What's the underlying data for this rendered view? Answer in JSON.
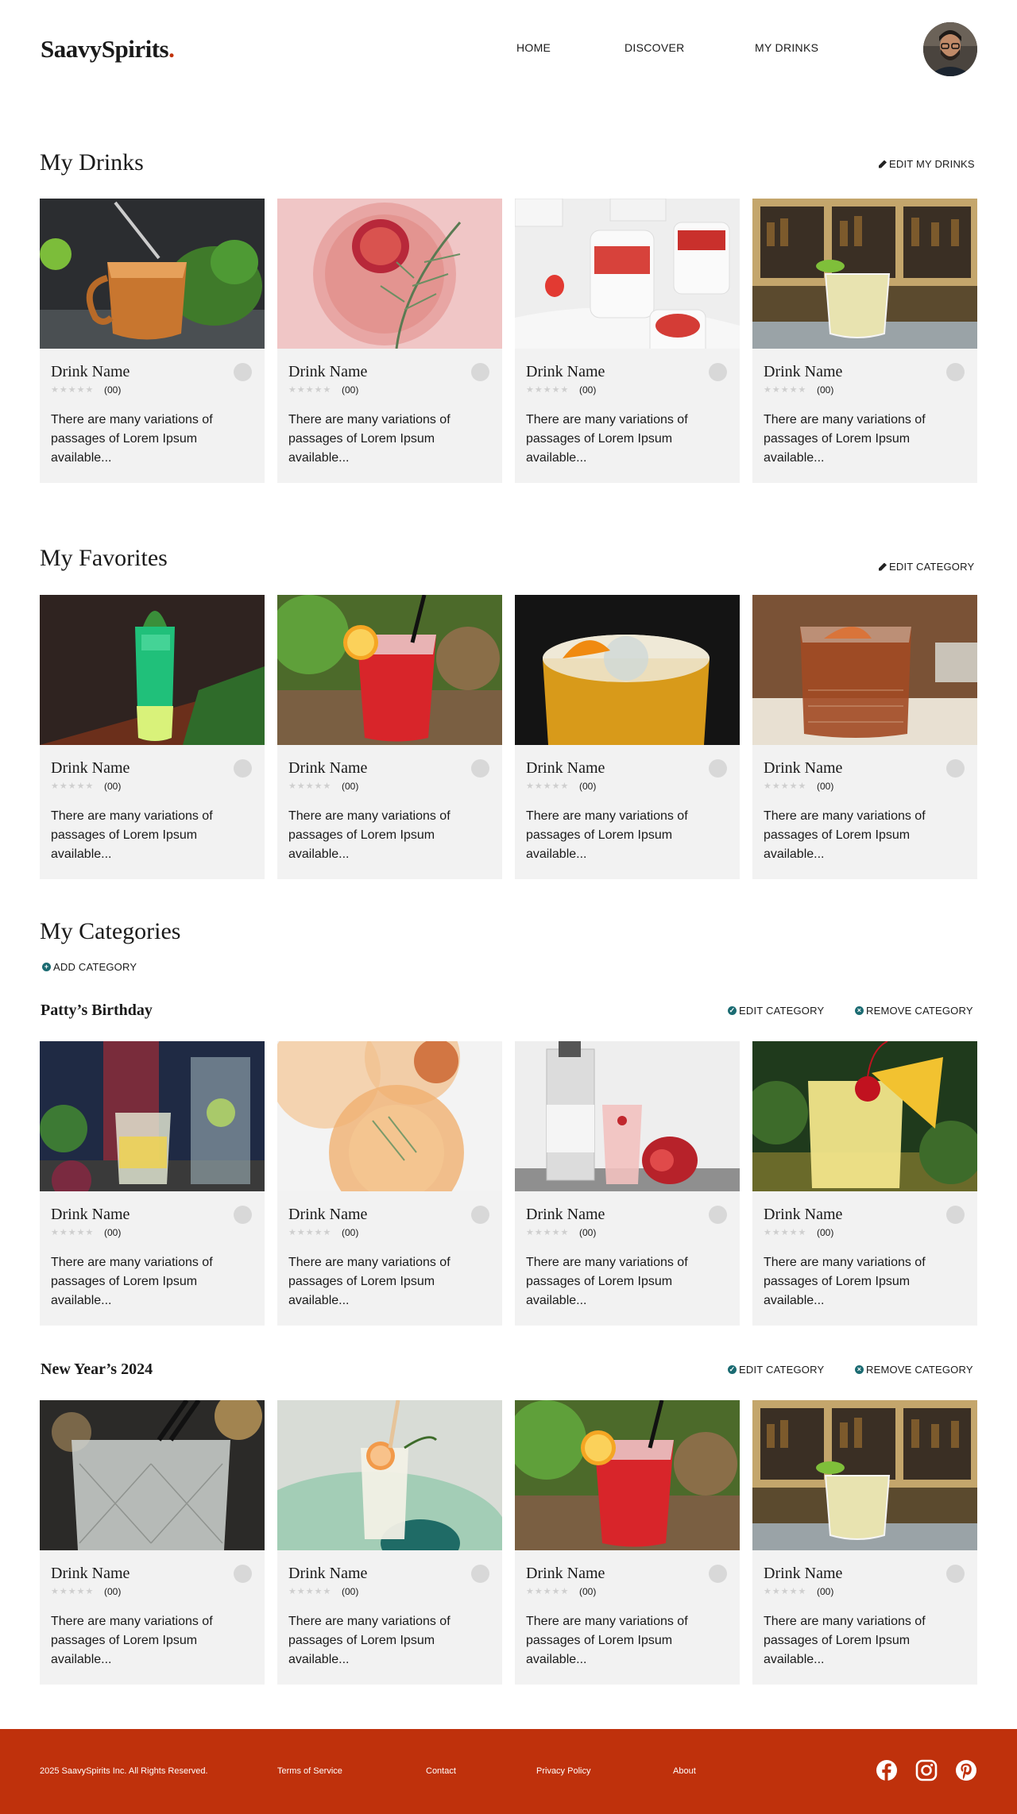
{
  "header": {
    "logo": "SaavySpirits",
    "logo_dot": ".",
    "nav": [
      "HOME",
      "DISCOVER",
      "MY DRINKS"
    ]
  },
  "my_drinks": {
    "title": "My Drinks",
    "action": "EDIT MY DRINKS"
  },
  "my_favorites": {
    "title": "My Favorites",
    "action": "EDIT CATEGORY"
  },
  "my_categories": {
    "title": "My Categories",
    "add": "ADD CATEGORY",
    "edit": "EDIT CATEGORY",
    "remove": "REMOVE CATEGORY",
    "groups": [
      "Patty’s Birthday",
      "New Year’s 2024"
    ]
  },
  "card": {
    "name": "Drink Name",
    "stars": "★★★★★",
    "count": "(00)",
    "desc": "There are many variations of passages of Lorem Ipsum available..."
  },
  "footer": {
    "copyright": "2025 SaavySpirits Inc. All Rights Reserved.",
    "links": [
      "Terms of Service",
      "Contact",
      "Privacy Policy",
      "About"
    ]
  },
  "colors": {
    "brand": "#bf310c",
    "accent": "#1b6b72",
    "card_bg": "#f2f2f2"
  },
  "icons": [
    "pencil-icon",
    "check-circle-icon",
    "remove-circle-icon",
    "plus-circle-icon",
    "facebook-icon",
    "instagram-icon",
    "pinterest-icon"
  ]
}
